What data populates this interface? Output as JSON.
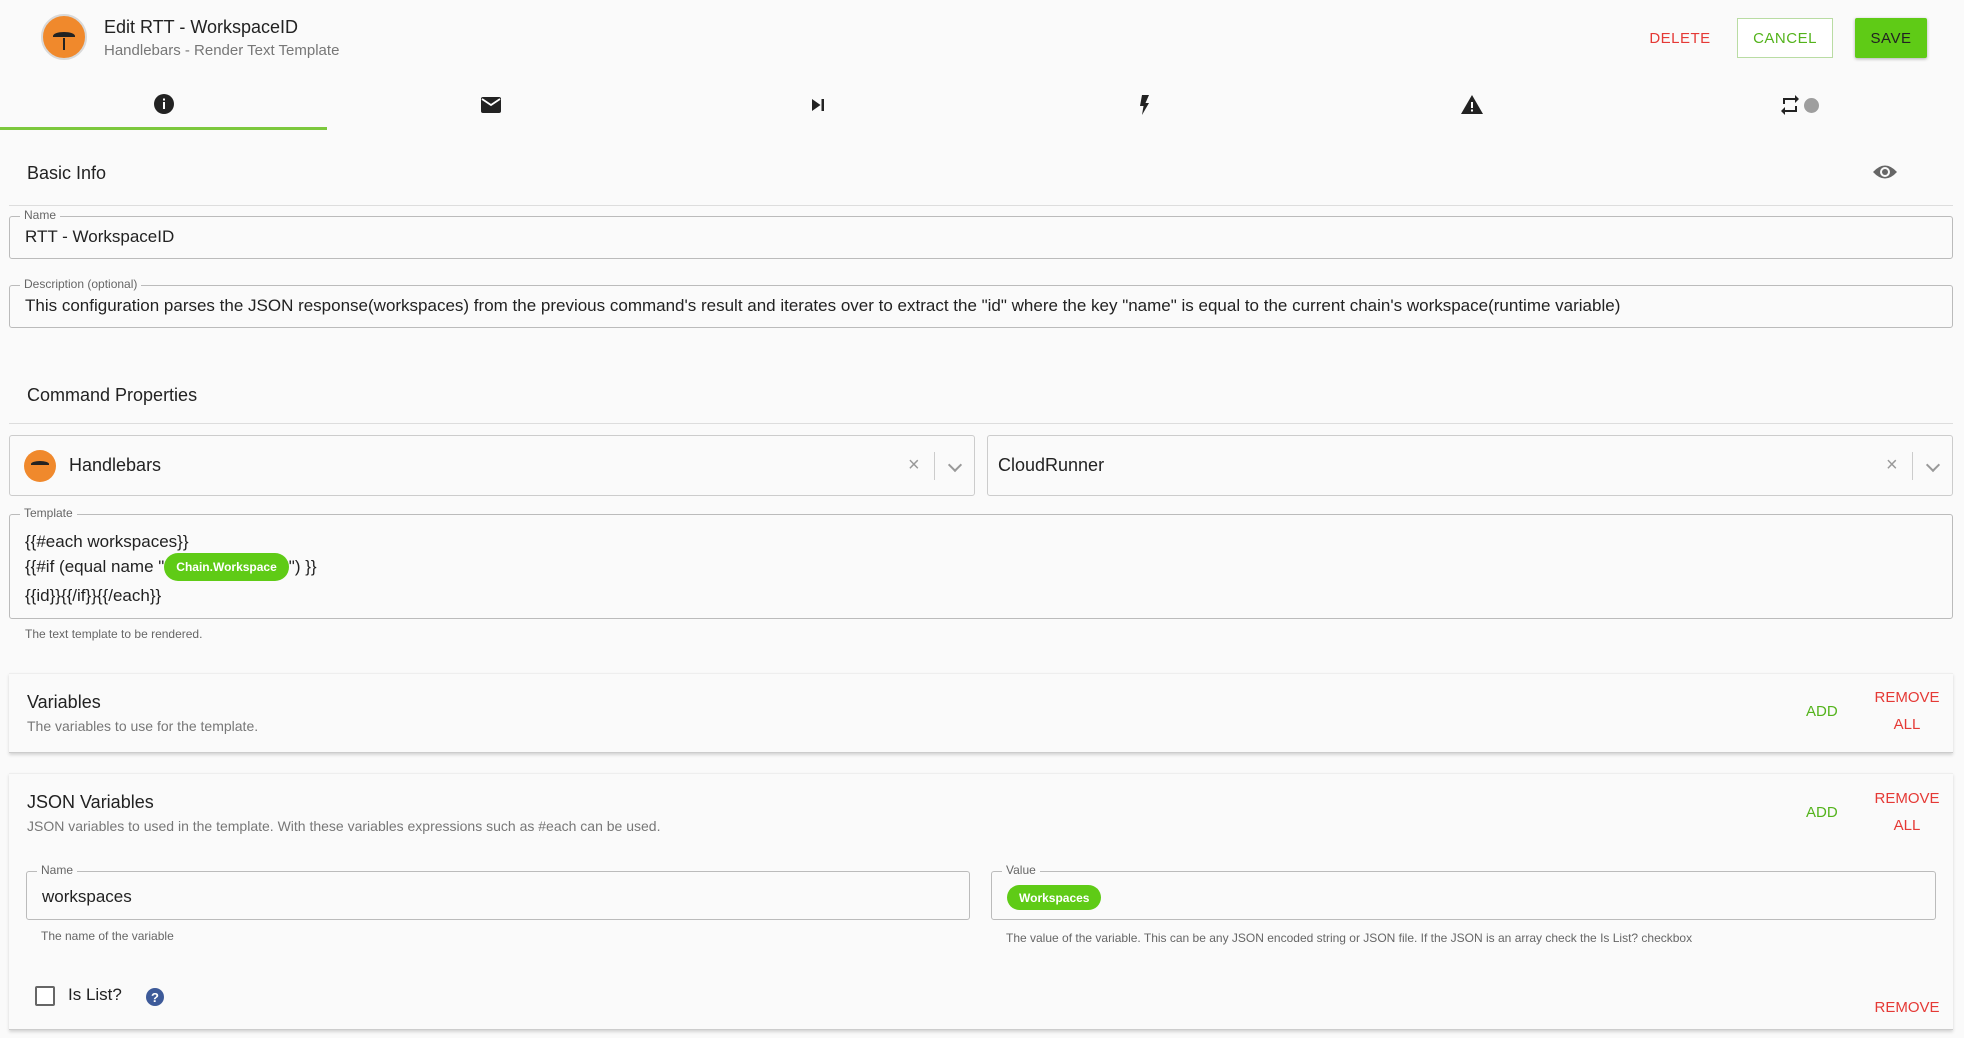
{
  "header": {
    "title": "Edit RTT - WorkspaceID",
    "subtitle": "Handlebars - Render Text Template",
    "delete_label": "DELETE",
    "cancel_label": "CANCEL",
    "save_label": "SAVE"
  },
  "tabs": [
    {
      "icon": "info-icon",
      "active": true
    },
    {
      "icon": "mail-icon",
      "active": false
    },
    {
      "icon": "skip-next-icon",
      "active": false
    },
    {
      "icon": "lightning-icon",
      "active": false
    },
    {
      "icon": "warning-icon",
      "active": false
    },
    {
      "icon": "repeat-icon",
      "active": false
    }
  ],
  "basic_info": {
    "title": "Basic Info",
    "name_label": "Name",
    "name_value": "RTT - WorkspaceID",
    "description_label": "Description (optional)",
    "description_value": "This configuration parses the JSON response(workspaces) from the previous command's result and iterates over to extract the \"id\" where the key \"name\" is equal to the current chain's workspace(runtime variable)"
  },
  "command_properties": {
    "title": "Command Properties",
    "command_select": "Handlebars",
    "runner_select": "CloudRunner",
    "template_label": "Template",
    "template_line1": "{{#each workspaces}}",
    "template_line2_prefix": "{{#if (equal name \"",
    "template_chip": "Chain.Workspace",
    "template_line2_suffix": "\") }}",
    "template_line3": "{{id}}{{/if}}{{/each}}",
    "template_help": "The text template to be rendered."
  },
  "variables": {
    "title": "Variables",
    "subtitle": "The variables to use for the template.",
    "add_label": "ADD",
    "remove_all_line1": "REMOVE",
    "remove_all_line2": "ALL"
  },
  "json_variables": {
    "title": "JSON Variables",
    "subtitle": "JSON variables to used in the template. With these variables expressions such as #each can be used.",
    "add_label": "ADD",
    "remove_all_line1": "REMOVE",
    "remove_all_line2": "ALL",
    "name_label": "Name",
    "name_value": "workspaces",
    "name_help": "The name of the variable",
    "value_label": "Value",
    "value_chip": "Workspaces",
    "value_help": "The value of the variable. This can be any JSON encoded string or JSON file. If the JSON is an array check the Is List? checkbox",
    "is_list_label": "Is List?",
    "is_list_checked": false,
    "help_glyph": "?",
    "remove_label": "REMOVE"
  },
  "colors": {
    "accent_green": "#5fcb16",
    "danger_red": "#e53935",
    "logo_orange": "#f0892c"
  }
}
